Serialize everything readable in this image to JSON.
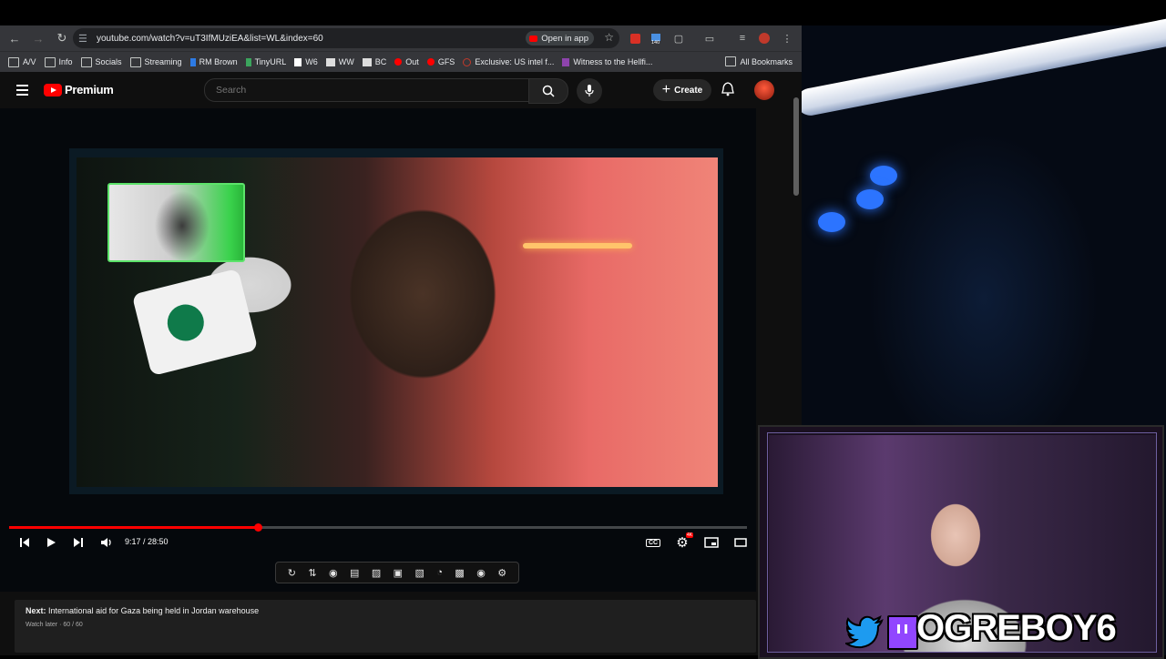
{
  "browser": {
    "url": "youtube.com/watch?v=uT3IfMUziEA&list=WL&index=60",
    "open_in_app_label": "Open in app",
    "ext_badge": "140",
    "bookmarks": [
      "A/V",
      "Info",
      "Socials",
      "Streaming",
      "RM Brown",
      "TinyURL",
      "W6",
      "WW",
      "BC",
      "Out",
      "GFS",
      "Exclusive: US intel f...",
      "Witness to the Hellfi..."
    ],
    "all_bookmarks_label": "All Bookmarks"
  },
  "youtube": {
    "logo_text": "Premium",
    "search_placeholder": "Search",
    "create_label": "Create",
    "player": {
      "current_time": "9:17",
      "duration": "28:50",
      "time_display": "9:17 / 28:50",
      "progress_fraction": 0.337,
      "hd_badge": "4K"
    },
    "next": {
      "prefix": "Next:",
      "title": "International aid for Gaza being held in Jordan warehouse",
      "sub": "Watch later · 60 / 60"
    }
  },
  "stream_overlay": {
    "channel_name": "OGREBOY6"
  },
  "colors": {
    "youtube_red": "#ff0000",
    "twitch_purple": "#9146ff",
    "twitter_blue": "#1d9bf0"
  }
}
